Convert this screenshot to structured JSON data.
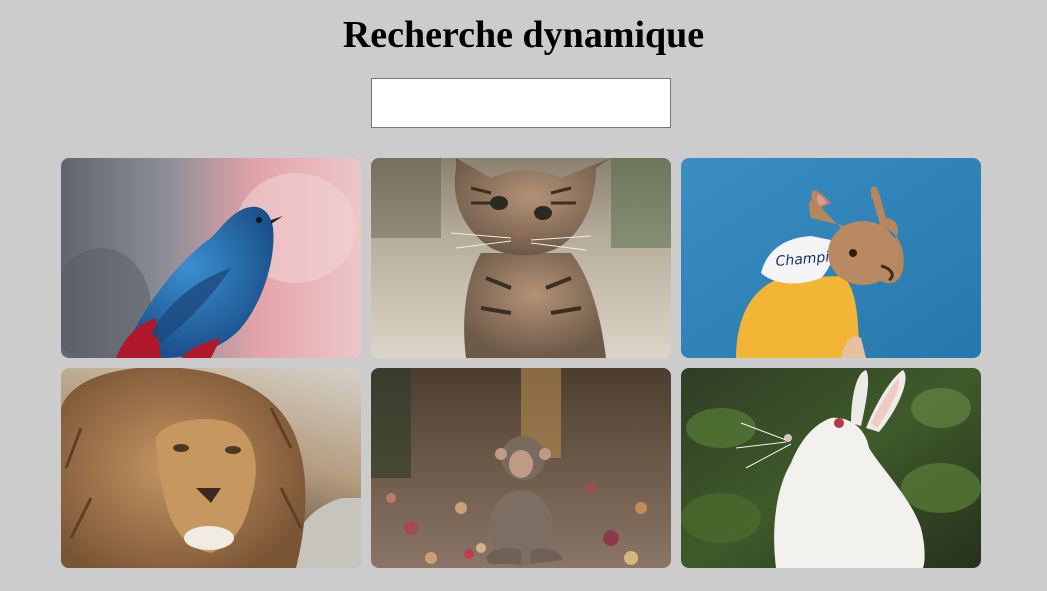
{
  "header": {
    "title": "Recherche dynamique"
  },
  "search": {
    "value": "",
    "placeholder": ""
  },
  "gallery": {
    "items": [
      {
        "animal": "bird",
        "icon": "bird-photo"
      },
      {
        "animal": "cat",
        "icon": "cat-photo"
      },
      {
        "animal": "dog",
        "icon": "dog-photo",
        "hoodie_text": "Champion"
      },
      {
        "animal": "lion",
        "icon": "lion-photo"
      },
      {
        "animal": "monkey",
        "icon": "monkey-photo"
      },
      {
        "animal": "rabbit",
        "icon": "rabbit-photo"
      }
    ]
  },
  "colors": {
    "page_background": "#cccccc",
    "input_border": "#767676",
    "title_text": "#000000"
  }
}
